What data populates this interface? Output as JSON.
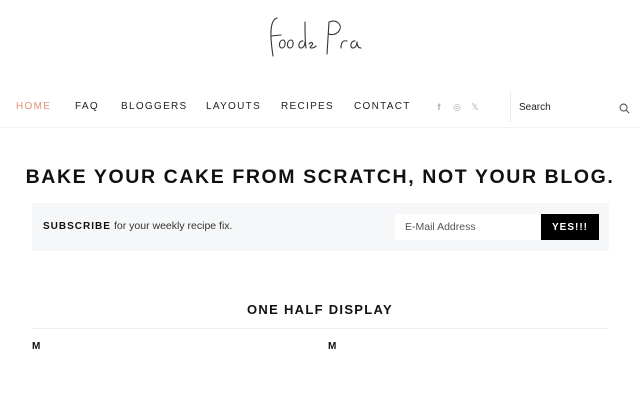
{
  "logo": {
    "text": "foodie Pro"
  },
  "nav": {
    "items": [
      {
        "label": "HOME",
        "active": true
      },
      {
        "label": "FAQ",
        "active": false
      },
      {
        "label": "BLOGGERS",
        "active": false
      },
      {
        "label": "LAYOUTS",
        "active": false
      },
      {
        "label": "RECIPES",
        "active": false
      },
      {
        "label": "CONTACT",
        "active": false
      }
    ],
    "social": [
      {
        "icon": "facebook-icon",
        "glyph": "f"
      },
      {
        "icon": "instagram-icon",
        "glyph": "◎"
      },
      {
        "icon": "x-twitter-icon",
        "glyph": "𝕏"
      }
    ],
    "search": {
      "placeholder": "Search",
      "icon": "search-icon"
    }
  },
  "headline": "BAKE YOUR CAKE FROM SCRATCH, NOT YOUR BLOG.",
  "subscribe": {
    "label": "SUBSCRIBE",
    "text": "for your weekly recipe fix.",
    "email_placeholder": "E-Mail Address",
    "button": "YES!!!"
  },
  "section": {
    "title": "ONE HALF DISPLAY",
    "columns": [
      "M",
      "M"
    ]
  },
  "colors": {
    "accent": "#e3907a",
    "text": "#111111",
    "muted": "#aaaaaa",
    "subscribe_bg": "#f6f7f8"
  }
}
